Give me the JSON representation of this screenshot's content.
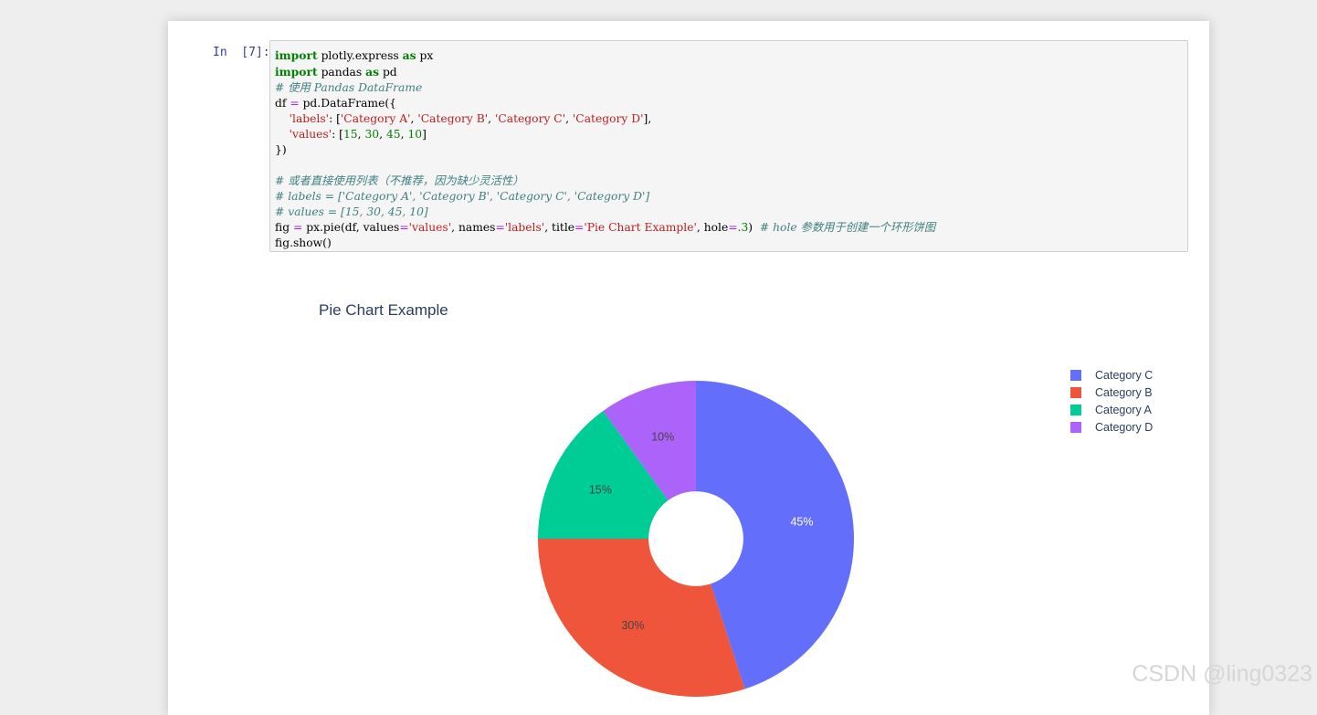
{
  "cell": {
    "prompt": "In  [7]:",
    "code_lines": [
      [
        {
          "t": "import",
          "c": "kw"
        },
        {
          "t": " plotly.express "
        },
        {
          "t": "as",
          "c": "kw"
        },
        {
          "t": " px"
        }
      ],
      [
        {
          "t": "import",
          "c": "kw"
        },
        {
          "t": " pandas "
        },
        {
          "t": "as",
          "c": "kw"
        },
        {
          "t": " pd"
        }
      ],
      [
        {
          "t": "# 使用 Pandas DataFrame",
          "c": "cm"
        }
      ],
      [
        {
          "t": "df "
        },
        {
          "t": "=",
          "c": "op"
        },
        {
          "t": " pd.DataFrame({"
        }
      ],
      [
        {
          "t": "    "
        },
        {
          "t": "'labels'",
          "c": "str"
        },
        {
          "t": ": ["
        },
        {
          "t": "'Category A'",
          "c": "str"
        },
        {
          "t": ", "
        },
        {
          "t": "'Category B'",
          "c": "str"
        },
        {
          "t": ", "
        },
        {
          "t": "'Category C'",
          "c": "str"
        },
        {
          "t": ", "
        },
        {
          "t": "'Category D'",
          "c": "str"
        },
        {
          "t": "],"
        }
      ],
      [
        {
          "t": "    "
        },
        {
          "t": "'values'",
          "c": "str"
        },
        {
          "t": ": ["
        },
        {
          "t": "15",
          "c": "num"
        },
        {
          "t": ", "
        },
        {
          "t": "30",
          "c": "num"
        },
        {
          "t": ", "
        },
        {
          "t": "45",
          "c": "num"
        },
        {
          "t": ", "
        },
        {
          "t": "10",
          "c": "num"
        },
        {
          "t": "]"
        }
      ],
      [
        {
          "t": "})"
        }
      ],
      [
        {
          "t": ""
        }
      ],
      [
        {
          "t": "# 或者直接使用列表（不推荐，因为缺少灵活性）",
          "c": "cm"
        }
      ],
      [
        {
          "t": "# labels = ['Category A', 'Category B', 'Category C', 'Category D']",
          "c": "cm"
        }
      ],
      [
        {
          "t": "# values = [15, 30, 45, 10]",
          "c": "cm"
        }
      ],
      [
        {
          "t": "fig "
        },
        {
          "t": "=",
          "c": "op"
        },
        {
          "t": " px.pie(df, values"
        },
        {
          "t": "=",
          "c": "op"
        },
        {
          "t": "'values'",
          "c": "str"
        },
        {
          "t": ", names"
        },
        {
          "t": "=",
          "c": "op"
        },
        {
          "t": "'labels'",
          "c": "str"
        },
        {
          "t": ", title"
        },
        {
          "t": "=",
          "c": "op"
        },
        {
          "t": "'Pie Chart Example'",
          "c": "str"
        },
        {
          "t": ", hole"
        },
        {
          "t": "=",
          "c": "op"
        },
        {
          "t": ".3",
          "c": "num"
        },
        {
          "t": ")  "
        },
        {
          "t": "# hole 参数用于创建一个环形饼图",
          "c": "cm"
        }
      ],
      [
        {
          "t": "fig.show()"
        }
      ]
    ]
  },
  "chart_data": {
    "type": "pie",
    "title": "Pie Chart Example",
    "hole": 0.3,
    "labels": [
      "Category C",
      "Category B",
      "Category A",
      "Category D"
    ],
    "values": [
      45,
      30,
      15,
      10
    ],
    "percent_labels": [
      "45%",
      "30%",
      "15%",
      "10%"
    ],
    "colors": [
      "#636efa",
      "#ef553b",
      "#00cc96",
      "#ab63fa"
    ],
    "label_colors": [
      "#ffffff",
      "#444444",
      "#444444",
      "#444444"
    ],
    "legend_position": "top-right"
  },
  "watermark": "CSDN @ling0323"
}
